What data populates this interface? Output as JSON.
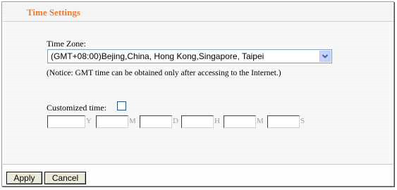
{
  "header": {
    "title": "Time Settings",
    "accent_color": "#f07a2a"
  },
  "time_zone": {
    "label": "Time Zone:",
    "selected": "(GMT+08:00)Bejing,China, Hong Kong,Singapore, Taipei",
    "dropdown_icon": "chevron-down-icon",
    "notice": "(Notice: GMT time can be obtained only after accessing to the Internet.)"
  },
  "customized_time": {
    "label": "Customized time:",
    "checked": false,
    "units": [
      "Y",
      "M",
      "D",
      "H",
      "M",
      "S"
    ]
  },
  "buttons": {
    "apply": "Apply",
    "cancel": "Cancel"
  }
}
